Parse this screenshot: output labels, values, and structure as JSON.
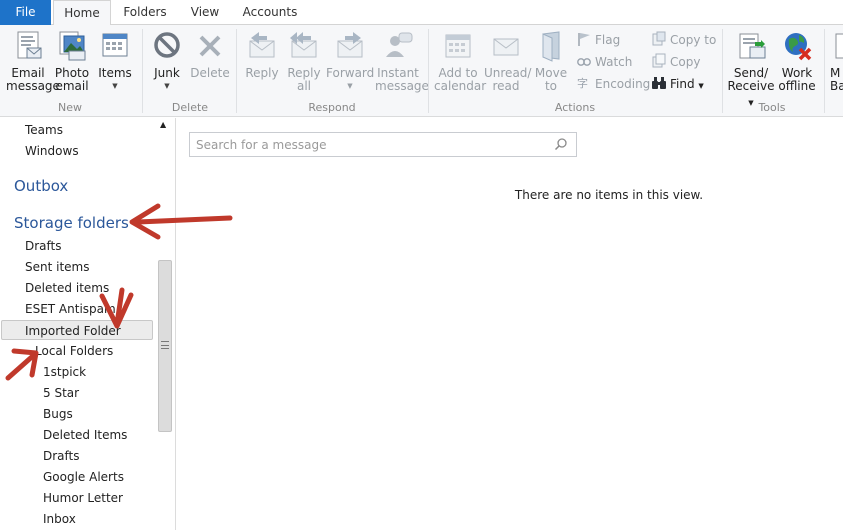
{
  "tabs": {
    "file": "File",
    "home": "Home",
    "folders": "Folders",
    "view": "View",
    "accounts": "Accounts"
  },
  "ribbon": {
    "new": {
      "group": "New",
      "email_message": [
        "Email",
        "message"
      ],
      "photo_email": [
        "Photo",
        "email"
      ],
      "items": "Items"
    },
    "delete": {
      "group": "Delete",
      "junk": "Junk",
      "delete": "Delete"
    },
    "respond": {
      "group": "Respond",
      "reply": "Reply",
      "reply_all": [
        "Reply",
        "all"
      ],
      "forward": "Forward",
      "instant_message": [
        "Instant",
        "message"
      ]
    },
    "actions": {
      "group": "Actions",
      "add_to_calendar": [
        "Add to",
        "calendar"
      ],
      "unread_read": [
        "Unread/",
        "read"
      ],
      "move_to": [
        "Move",
        "to"
      ],
      "flag": "Flag",
      "watch": "Watch",
      "encoding": "Encoding",
      "copy_to": "Copy to",
      "copy": "Copy",
      "find": "Find"
    },
    "tools": {
      "group": "Tools",
      "send_receive": [
        "Send/",
        "Receive"
      ],
      "work_offline": [
        "Work",
        "offline"
      ],
      "cut_off": [
        "M",
        "Ba"
      ]
    }
  },
  "folders": {
    "items_top": [
      "Teams",
      "Windows"
    ],
    "outbox": "Outbox",
    "storage_folders": "Storage folders",
    "storage_items": [
      "Drafts",
      "Sent items",
      "Deleted items",
      "ESET Antispam",
      "Imported Folder"
    ],
    "local_folders": "Local Folders",
    "local_items": [
      "1stpick",
      "5 Star",
      "Bugs",
      "Deleted Items",
      "Drafts",
      "Google Alerts",
      "Humor Letter",
      "Inbox"
    ]
  },
  "search": {
    "placeholder": "Search for a message"
  },
  "messages": {
    "empty_text": "There are no items in this view."
  },
  "colors": {
    "file_tab": "#1e73c9",
    "folder_heading": "#2b579a",
    "annotation_arrow": "#c0392b",
    "ribbon_bg": "#f6f7f9"
  }
}
